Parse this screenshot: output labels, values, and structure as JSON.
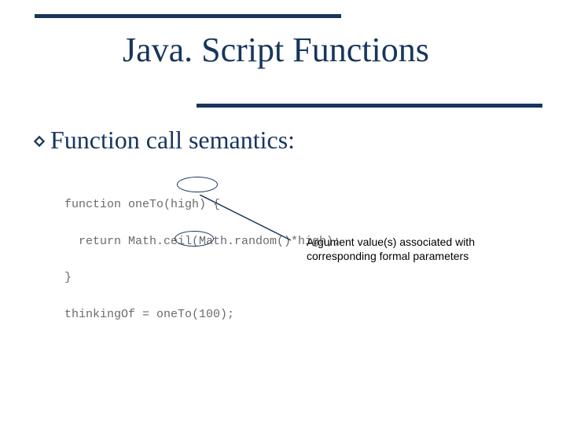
{
  "title": "Java. Script Functions",
  "bullet": "Function call semantics:",
  "code": {
    "line1": "function oneTo(high) {",
    "line2": "  return Math.ceil(Math.random()*high);",
    "line3": "}",
    "line4": "thinkingOf = oneTo(100);"
  },
  "annotation": "Argument value(s) associated with corresponding formal parameters",
  "colors": {
    "accent": "#17365d"
  }
}
